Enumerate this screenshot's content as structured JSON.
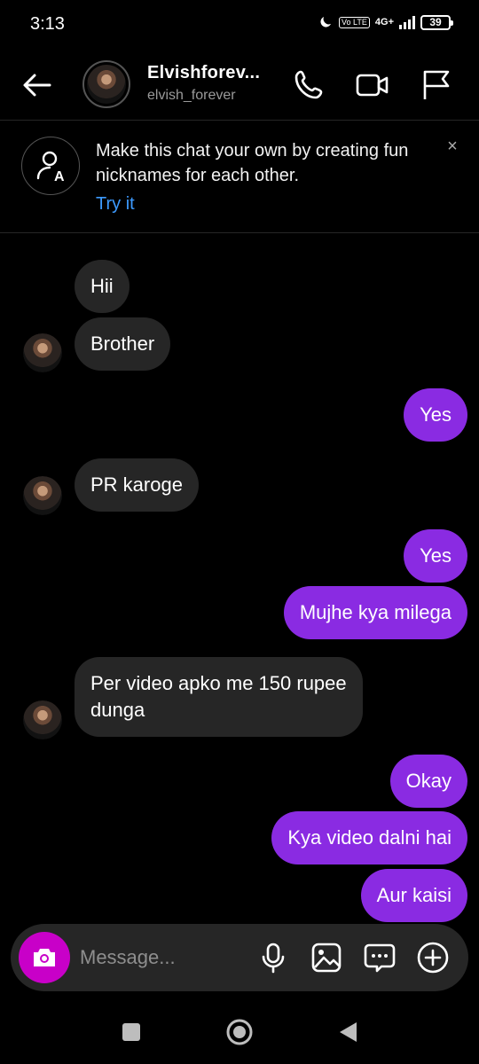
{
  "status_bar": {
    "time": "3:13",
    "network_badge": "Vo LTE",
    "network_type": "4G+",
    "battery": "39"
  },
  "header": {
    "display_name": "Elvishforev...",
    "username": "elvish_forever"
  },
  "banner": {
    "text": "Make this chat your own by creating fun nicknames for each other.",
    "link": "Try it",
    "close": "×"
  },
  "messages": [
    {
      "side": "received",
      "text": "Hii"
    },
    {
      "side": "received",
      "text": "Brother"
    },
    {
      "side": "sent",
      "text": "Yes"
    },
    {
      "side": "received",
      "text": "PR karoge"
    },
    {
      "side": "sent",
      "text": "Yes"
    },
    {
      "side": "sent",
      "text": "Mujhe kya milega"
    },
    {
      "side": "received",
      "text_line1": "Per video apko me 150 rupee",
      "text_line2": "dunga"
    },
    {
      "side": "sent",
      "text": "Okay"
    },
    {
      "side": "sent",
      "text": "Kya video dalni hai"
    },
    {
      "side": "sent",
      "text": "Aur kaisi"
    }
  ],
  "composer": {
    "placeholder": "Message..."
  },
  "colors": {
    "sent_bubble": "#8a2be2",
    "received_bubble": "#262626",
    "camera_button": "#c800c8",
    "link": "#3d9bff"
  },
  "icons": [
    "back-arrow-icon",
    "phone-icon",
    "video-camera-icon",
    "flag-icon",
    "nickname-icon",
    "camera-icon",
    "microphone-icon",
    "gallery-icon",
    "sticker-chat-icon",
    "plus-circle-icon"
  ]
}
